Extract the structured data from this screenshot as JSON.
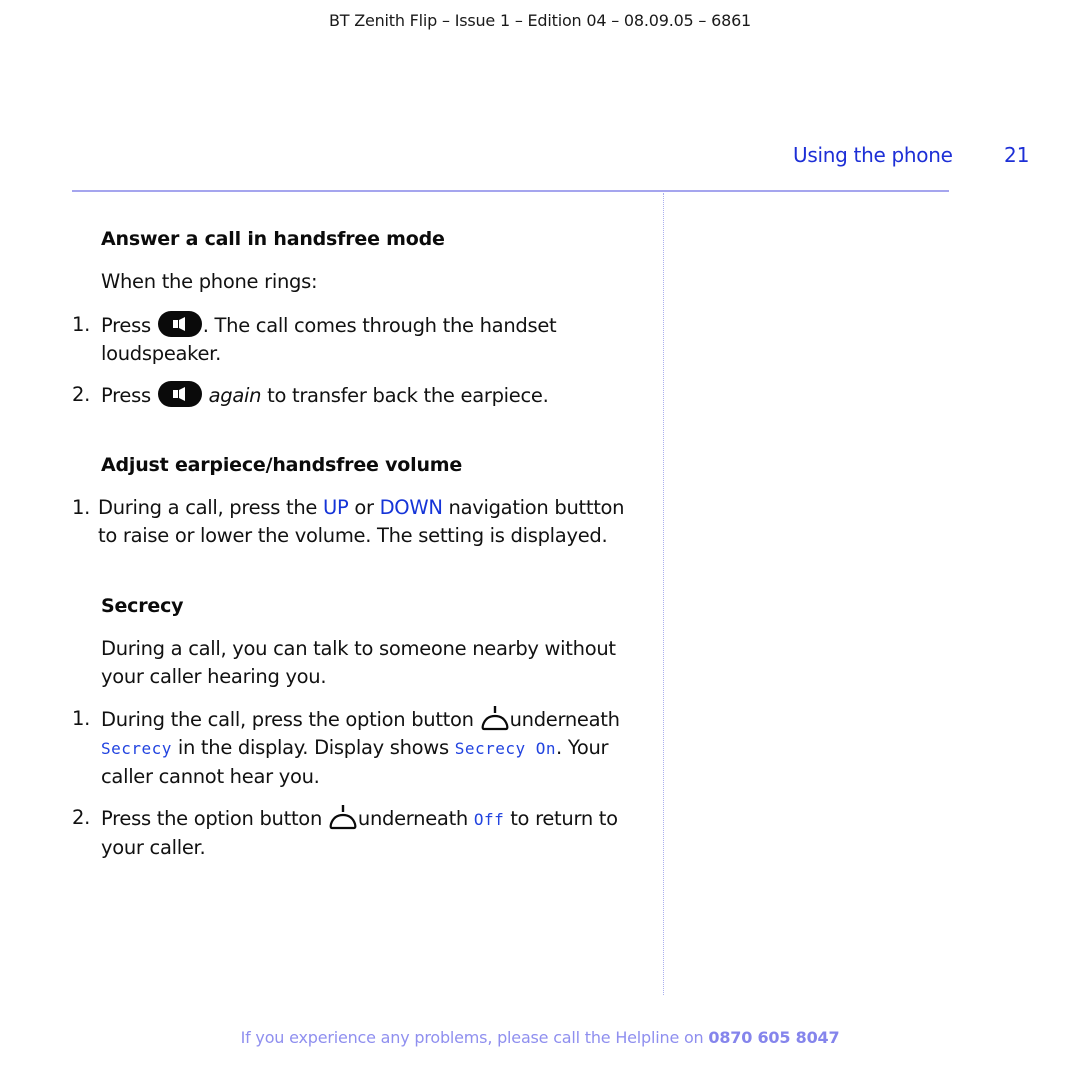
{
  "document": {
    "meta_line": "BT Zenith Flip – Issue 1 – Edition 04 – 08.09.05 – 6861",
    "running_head": "Using the phone",
    "page_number": "21"
  },
  "sections": {
    "handsfree": {
      "title": "Answer a call in handsfree mode",
      "intro": "When the phone rings:",
      "steps": [
        {
          "num": "1.",
          "before": "Press ",
          "icon": "speaker-button-icon",
          "after_line1": ". The call comes through the handset",
          "after_line2": "loudspeaker."
        },
        {
          "num": "2.",
          "before": "Press ",
          "icon": "speaker-button-icon",
          "italic": "again",
          "after": " to transfer back the earpiece."
        }
      ]
    },
    "volume": {
      "title": "Adjust earpiece/handsfree volume",
      "steps": [
        {
          "num": "1.",
          "text1": "During a call, press the ",
          "key_up": "UP",
          "text2": " or ",
          "key_down": "DOWN",
          "text3": " navigation buttton",
          "line2": "to raise or lower the volume. The setting is displayed."
        }
      ]
    },
    "secrecy": {
      "title": "Secrecy",
      "intro_line1": "During a call, you can talk to someone nearby without",
      "intro_line2": "your caller hearing you.",
      "steps": [
        {
          "num": "1.",
          "text1": "During the call, press the option button ",
          "icon": "option-button-icon",
          "text2": "underneath",
          "display1": "Secrecy",
          "text3": " in the display. Display shows ",
          "display2": "Secrecy On",
          "text4": ". Your",
          "line3": "caller cannot hear you."
        },
        {
          "num": "2.",
          "text1": "Press the option button ",
          "icon": "option-button-icon",
          "text2": "underneath ",
          "display1": "Off",
          "text3": " to return to",
          "line2": "your caller."
        }
      ]
    }
  },
  "footer": {
    "text": "If you experience any problems, please call the Helpline on ",
    "phone": "0870 605 8047"
  },
  "colors": {
    "accent_blue": "#1d2fd6",
    "lcd_blue": "#2244e0",
    "rule_lavender": "#a5a5ee",
    "footer_lavender": "#8f8fef"
  }
}
